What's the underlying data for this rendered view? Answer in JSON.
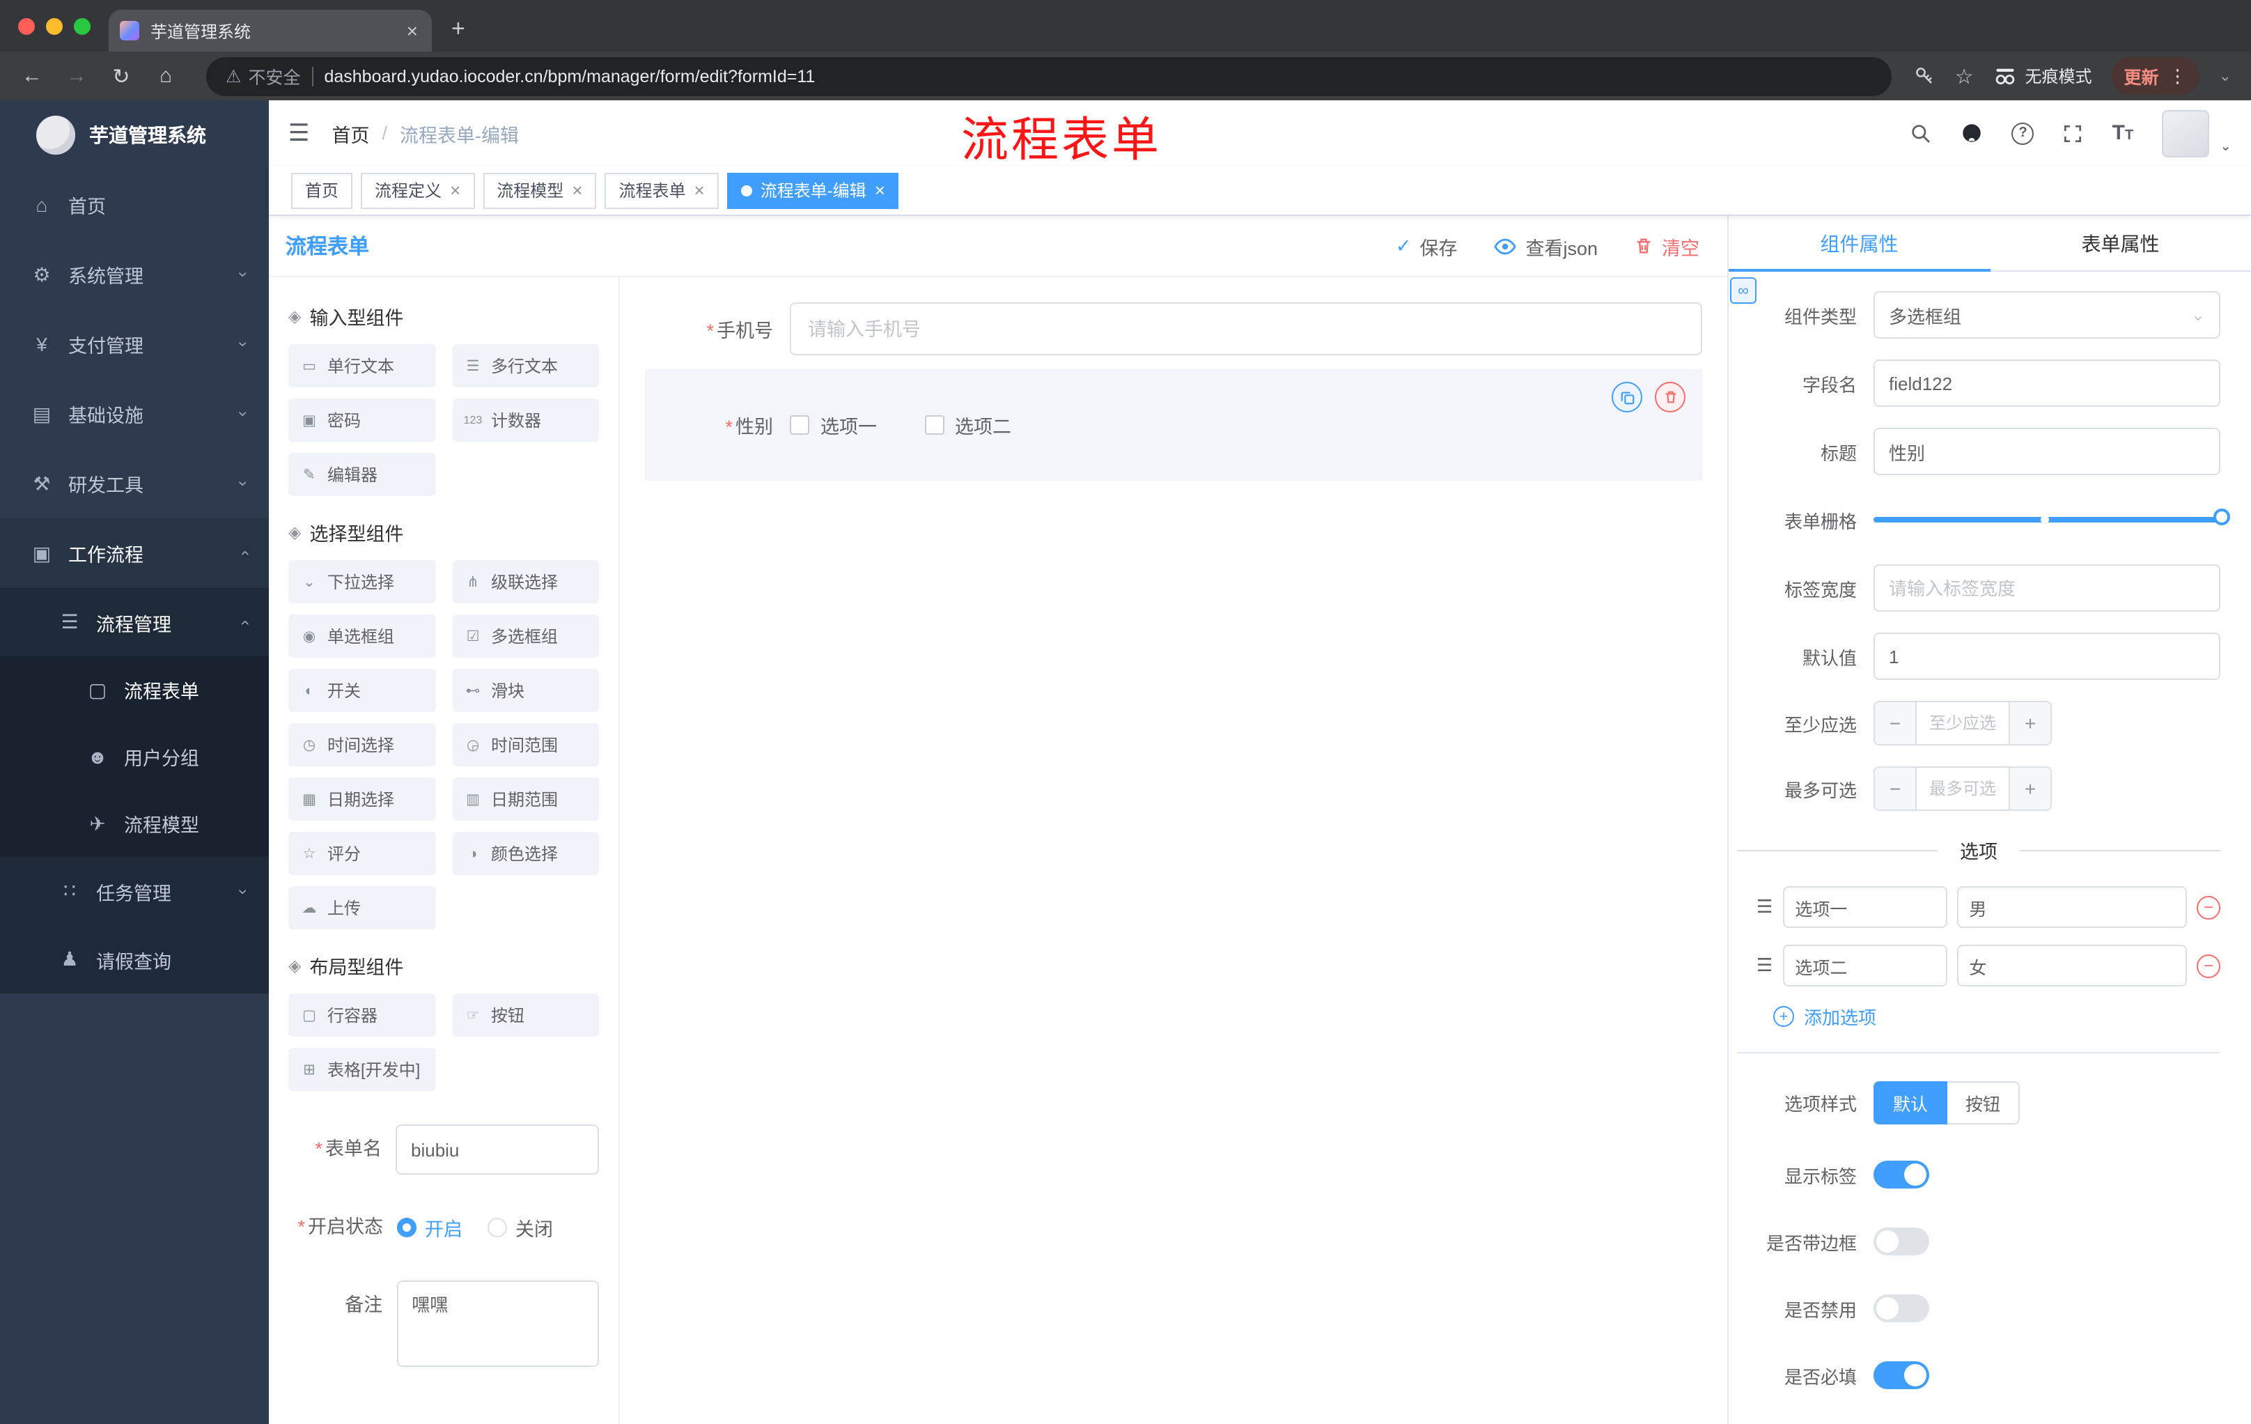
{
  "glyphs": {
    "close": "×",
    "plus": "+",
    "more": "⋮",
    "chevron": "›",
    "chevron_down": "⌄",
    "back": "←",
    "forward": "→",
    "reload": "↻",
    "home": "⌂",
    "warn": "⚠",
    "star": "☆",
    "menu": "☰",
    "slash": "/",
    "check": "✓",
    "minus": "−",
    "plus_sm": "+",
    "asterisk": "*",
    "drag": "☰",
    "link": "∞",
    "qmark": "?",
    "tsize_big": "T",
    "tsize_small": "T"
  },
  "colors": {
    "accent": "#409eff",
    "danger": "#f56c6c",
    "annotation": "#fe1515"
  },
  "browser": {
    "tab_title": "芋道管理系统",
    "security_label": "不安全",
    "url": "dashboard.yudao.iocoder.cn/bpm/manager/form/edit?formId=11",
    "incognito_label": "无痕模式",
    "update_label": "更新"
  },
  "sidebar": {
    "app_title": "芋道管理系统",
    "items": [
      {
        "icon": "⌂",
        "label": "首页"
      },
      {
        "icon": "⚙",
        "label": "系统管理"
      },
      {
        "icon": "¥",
        "label": "支付管理"
      },
      {
        "icon": "▤",
        "label": "基础设施"
      },
      {
        "icon": "⚒",
        "label": "研发工具"
      },
      {
        "icon": "▣",
        "label": "工作流程"
      },
      {
        "icon": "☰",
        "label": "流程管理"
      },
      {
        "icon": "▢",
        "label": "流程表单"
      },
      {
        "icon": "☻",
        "label": "用户分组"
      },
      {
        "icon": "✈",
        "label": "流程模型"
      },
      {
        "icon": "∷",
        "label": "任务管理"
      },
      {
        "icon": "♟",
        "label": "请假查询"
      }
    ]
  },
  "header": {
    "breadcrumb_home": "首页",
    "breadcrumb_current": "流程表单-编辑",
    "annotation": "流程表单"
  },
  "tags": [
    {
      "label": "首页"
    },
    {
      "label": "流程定义"
    },
    {
      "label": "流程模型"
    },
    {
      "label": "流程表单"
    },
    {
      "label": "流程表单-编辑"
    }
  ],
  "designer": {
    "panel_title": "流程表单",
    "save_label": "保存",
    "view_json_label": "查看json",
    "clear_label": "清空",
    "groups": [
      {
        "title": "输入型组件",
        "items": [
          {
            "icon": "▭",
            "label": "单行文本"
          },
          {
            "icon": "☰",
            "label": "多行文本"
          },
          {
            "icon": "▣",
            "label": "密码"
          },
          {
            "icon": "123",
            "label": "计数器"
          },
          {
            "icon": "✎",
            "label": "编辑器"
          }
        ]
      },
      {
        "title": "选择型组件",
        "items": [
          {
            "icon": "⌄",
            "label": "下拉选择"
          },
          {
            "icon": "⋔",
            "label": "级联选择"
          },
          {
            "icon": "◉",
            "label": "单选框组"
          },
          {
            "icon": "☑",
            "label": "多选框组"
          },
          {
            "icon": "◐",
            "label": "开关"
          },
          {
            "icon": "⊷",
            "label": "滑块"
          },
          {
            "icon": "◷",
            "label": "时间选择"
          },
          {
            "icon": "◶",
            "label": "时间范围"
          },
          {
            "icon": "▦",
            "label": "日期选择"
          },
          {
            "icon": "▥",
            "label": "日期范围"
          },
          {
            "icon": "☆",
            "label": "评分"
          },
          {
            "icon": "◑",
            "label": "颜色选择"
          },
          {
            "icon": "☁",
            "label": "上传"
          }
        ]
      },
      {
        "title": "布局型组件",
        "items": [
          {
            "icon": "▢",
            "label": "行容器"
          },
          {
            "icon": "☞",
            "label": "按钮"
          },
          {
            "icon": "⊞",
            "label": "表格[开发中]"
          }
        ]
      }
    ],
    "meta": {
      "name_label": "表单名",
      "name_value": "biubiu",
      "status_label": "开启状态",
      "status_on": "开启",
      "status_off": "关闭",
      "remark_label": "备注",
      "remark_value": "嘿嘿"
    },
    "canvas": {
      "phone_label": "手机号",
      "phone_placeholder": "请输入手机号",
      "gender_label": "性别",
      "gender_opt1": "选项一",
      "gender_opt2": "选项二"
    }
  },
  "props": {
    "tab_component": "组件属性",
    "tab_form": "表单属性",
    "component_type_label": "组件类型",
    "component_type_value": "多选框组",
    "field_name_label": "字段名",
    "field_name_value": "field122",
    "title_label": "标题",
    "title_value": "性别",
    "grid_label": "表单栅格",
    "label_width_label": "标签宽度",
    "label_width_placeholder": "请输入标签宽度",
    "default_label": "默认值",
    "default_value": "1",
    "min_label": "至少应选",
    "min_placeholder": "至少应选",
    "max_label": "最多可选",
    "max_placeholder": "最多可选",
    "options_title": "选项",
    "options": [
      {
        "text": "选项一",
        "value": "男"
      },
      {
        "text": "选项二",
        "value": "女"
      }
    ],
    "add_option_label": "添加选项",
    "style_label": "选项样式",
    "style_default": "默认",
    "style_button": "按钮",
    "switch_show_label": "显示标签",
    "switch_border_label": "是否带边框",
    "switch_disabled_label": "是否禁用",
    "switch_required_label": "是否必填"
  }
}
